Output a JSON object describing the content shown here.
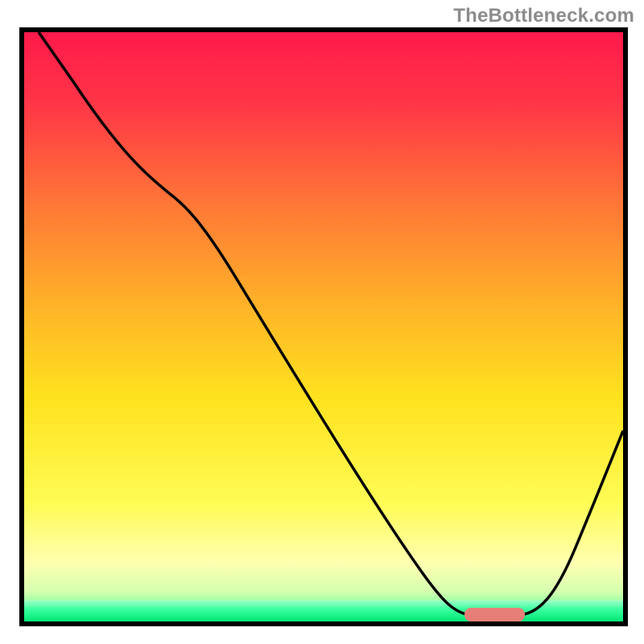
{
  "watermark": "TheBottleneck.com",
  "colors": {
    "top": "#ff1a4b",
    "mid_orange": "#ff7a36",
    "mid_yellow": "#ffe21e",
    "pale_yellow": "#ffffb0",
    "green": "#00e876",
    "marker": "#e77f78",
    "frame": "#000000"
  },
  "chart_data": {
    "type": "line",
    "title": "",
    "xlabel": "",
    "ylabel": "",
    "xlim": [
      0,
      100
    ],
    "ylim": [
      0,
      100
    ],
    "grid": false,
    "legend": false,
    "series": [
      {
        "name": "bottleneck-curve",
        "x": [
          2,
          8,
          24,
          35,
          45,
          58,
          66,
          72,
          75,
          80,
          83,
          88,
          92,
          96,
          100
        ],
        "y": [
          100,
          92,
          73,
          59,
          44,
          22,
          10,
          3,
          1,
          1,
          1,
          5,
          15,
          25,
          33
        ]
      }
    ],
    "annotations": [
      {
        "name": "optimal-range-marker",
        "shape": "rounded-rect",
        "x_range": [
          74,
          84
        ],
        "y": 2,
        "color": "#e77f78"
      }
    ],
    "background": {
      "type": "vertical-gradient",
      "stops": [
        {
          "pos": 0.0,
          "color": "#ff1a4b"
        },
        {
          "pos": 0.3,
          "color": "#ff7a36"
        },
        {
          "pos": 0.62,
          "color": "#ffe21e"
        },
        {
          "pos": 0.9,
          "color": "#ffffb0"
        },
        {
          "pos": 1.0,
          "color": "#00e876"
        }
      ]
    }
  }
}
